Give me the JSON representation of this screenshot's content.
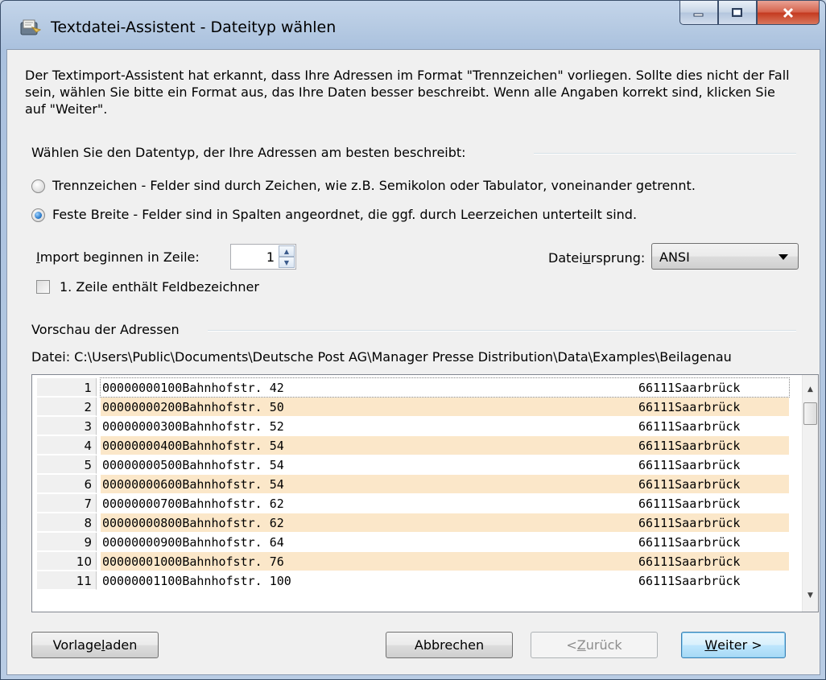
{
  "window": {
    "title": "Textdatei-Assistent - Dateityp wählen"
  },
  "intro_text": "Der Textimport-Assistent hat erkannt, dass Ihre Adressen im Format \"Trennzeichen\" vorliegen. Sollte dies nicht der Fall sein, wählen Sie bitte ein Format aus, das Ihre Daten besser beschreibt. Wenn alle Angaben korrekt sind, klicken Sie auf \"Weiter\".",
  "datatype_group": {
    "title": "Wählen Sie den Datentyp, der Ihre Adressen am besten beschreibt:",
    "options": [
      {
        "label": "Trennzeichen - Felder sind durch Zeichen, wie z.B. Semikolon oder Tabulator, voneinander getrennt.",
        "checked": false
      },
      {
        "label": "Feste Breite - Felder sind in Spalten angeordnet, die ggf. durch Leerzeichen unterteilt sind.",
        "checked": true
      }
    ]
  },
  "import_start": {
    "label_pre": "",
    "label_accel": "I",
    "label_post": "mport beginnen in Zeile:",
    "value": "1"
  },
  "origin": {
    "label_pre": "Datei",
    "label_accel": "u",
    "label_post": "rsprung:",
    "value": "ANSI"
  },
  "header_checkbox": {
    "label": "1. Zeile enthält Feldbezeichner",
    "checked": false
  },
  "preview": {
    "title": "Vorschau der Adressen",
    "file_path": "Datei: C:\\Users\\Public\\Documents\\Deutsche Post AG\\Manager Presse Distribution\\Data\\Examples\\Beilagenau",
    "rows": [
      {
        "num": "1",
        "col1": "00000000100Bahnhofstr. 42",
        "col2": "66111Saarbrück"
      },
      {
        "num": "2",
        "col1": "00000000200Bahnhofstr. 50",
        "col2": "66111Saarbrück"
      },
      {
        "num": "3",
        "col1": "00000000300Bahnhofstr. 52",
        "col2": "66111Saarbrück"
      },
      {
        "num": "4",
        "col1": "00000000400Bahnhofstr. 54",
        "col2": "66111Saarbrück"
      },
      {
        "num": "5",
        "col1": "00000000500Bahnhofstr. 54",
        "col2": "66111Saarbrück"
      },
      {
        "num": "6",
        "col1": "00000000600Bahnhofstr. 54",
        "col2": "66111Saarbrück"
      },
      {
        "num": "7",
        "col1": "00000000700Bahnhofstr. 62",
        "col2": "66111Saarbrück"
      },
      {
        "num": "8",
        "col1": "00000000800Bahnhofstr. 62",
        "col2": "66111Saarbrück"
      },
      {
        "num": "9",
        "col1": "00000000900Bahnhofstr. 64",
        "col2": "66111Saarbrück"
      },
      {
        "num": "10",
        "col1": "00000001000Bahnhofstr. 76",
        "col2": "66111Saarbrück"
      },
      {
        "num": "11",
        "col1": "00000001100Bahnhofstr. 100",
        "col2": "66111Saarbrück"
      }
    ]
  },
  "buttons": {
    "load_template_pre": "Vorlage ",
    "load_template_accel": "l",
    "load_template_post": "aden",
    "cancel": "Abbrechen",
    "back_pre": "< ",
    "back_accel": "Z",
    "back_post": "urück",
    "next_pre": "",
    "next_accel": "W",
    "next_post": "eiter >"
  },
  "colors": {
    "alt_row": "#fbe7c9",
    "default_button_border": "#3c7fb1"
  }
}
